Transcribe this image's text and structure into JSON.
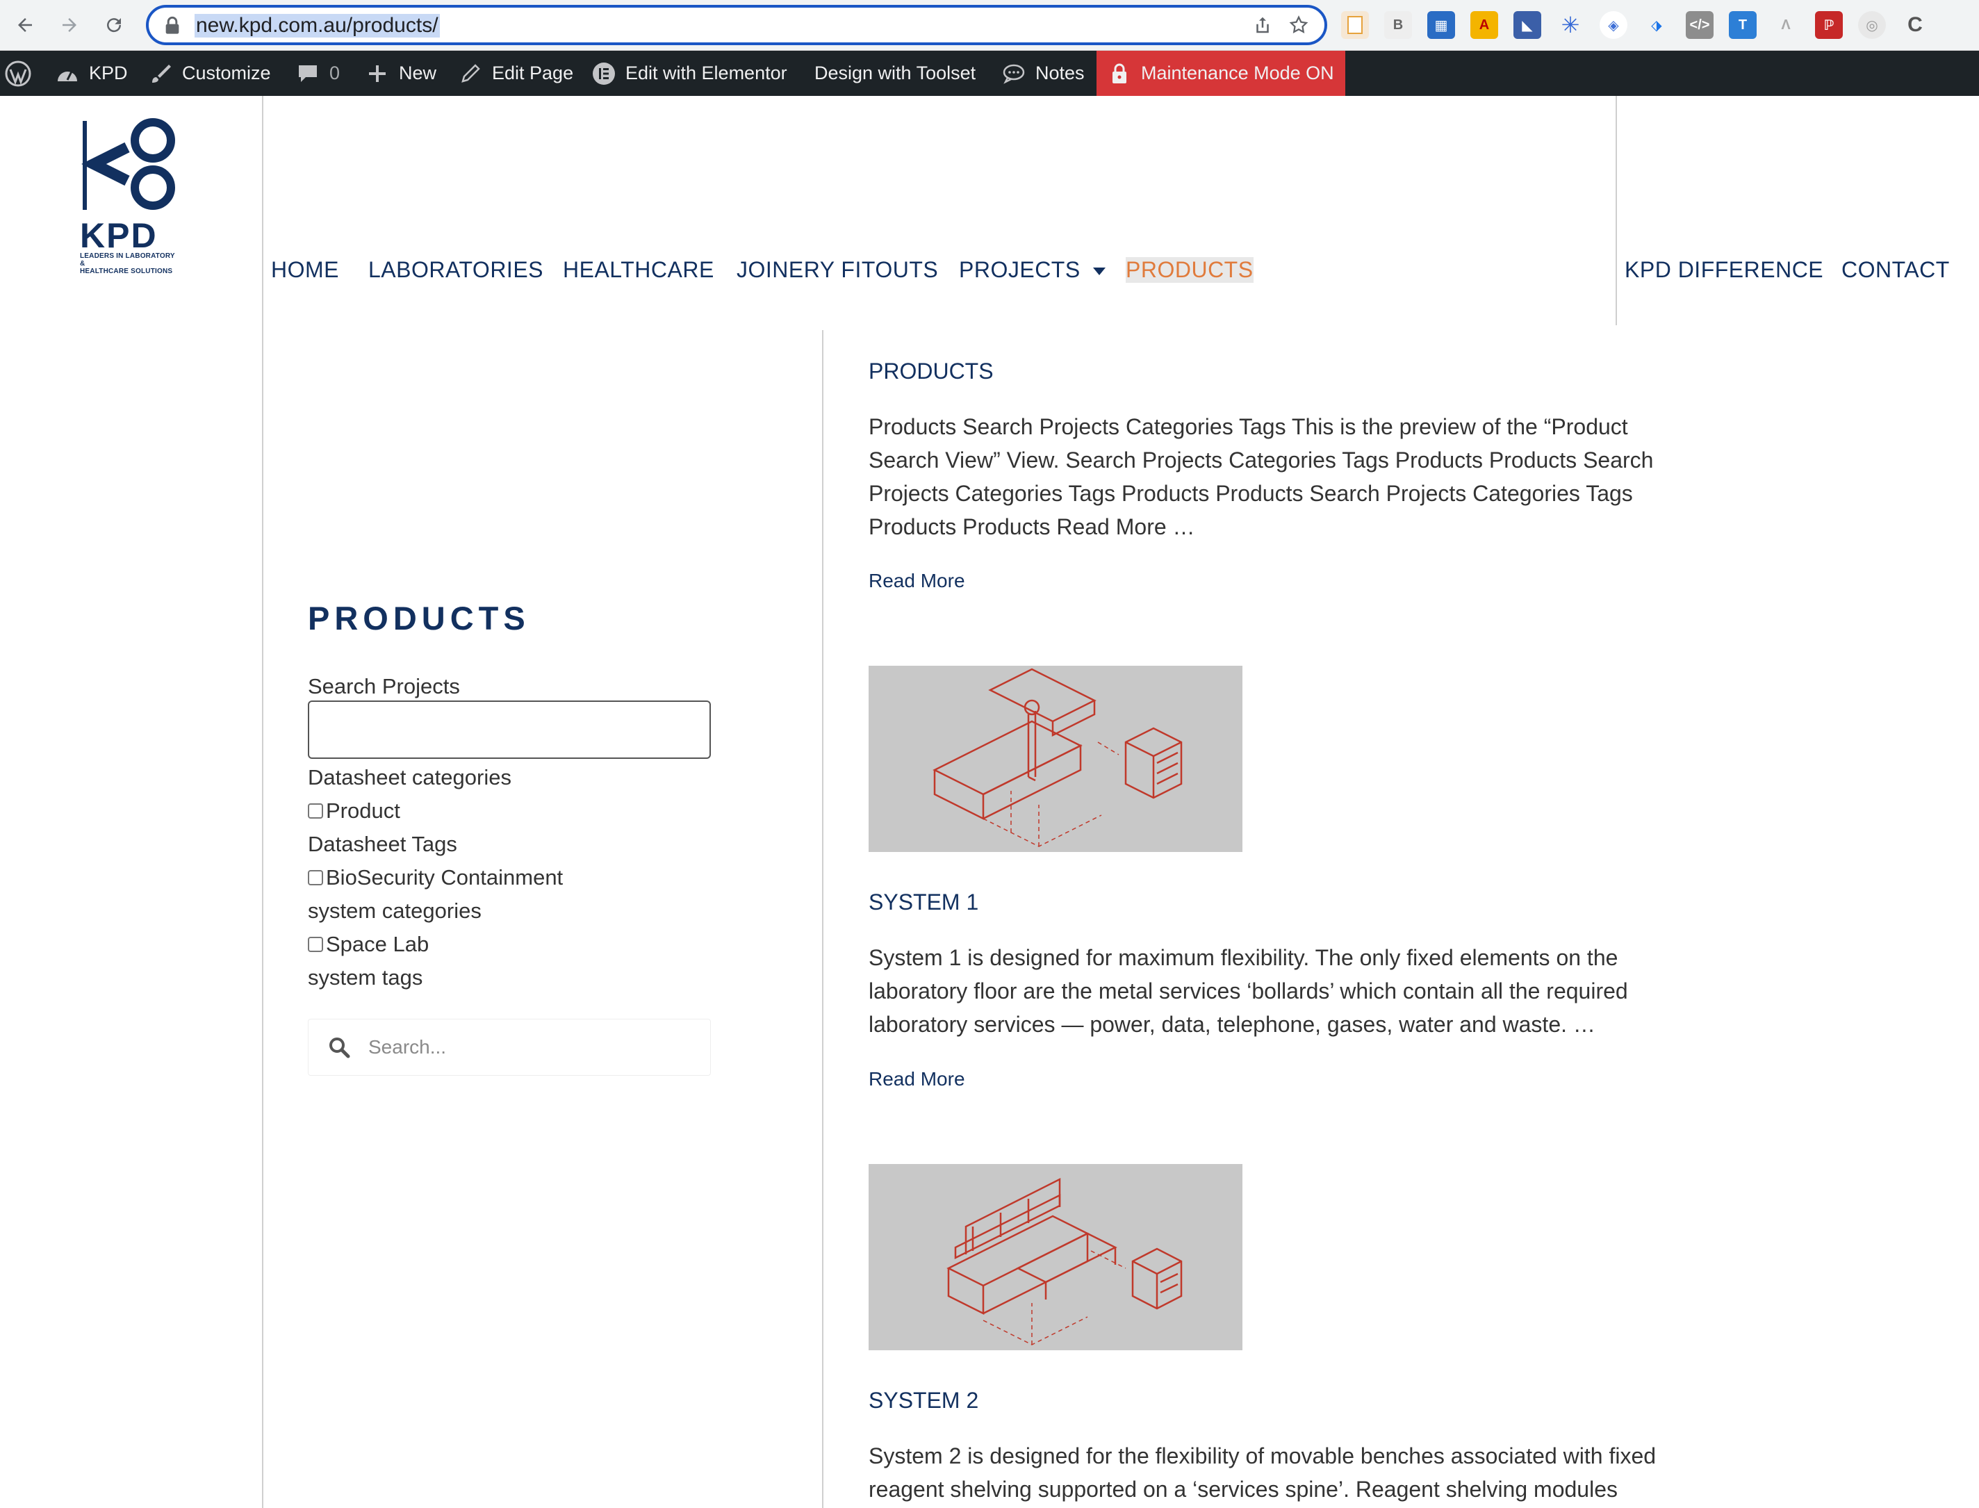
{
  "browser": {
    "url": "new.kpd.com.au/products/"
  },
  "adminbar": {
    "site": "KPD",
    "customize": "Customize",
    "comments_count": "0",
    "new": "New",
    "edit_page": "Edit Page",
    "edit_elementor": "Edit with Elementor",
    "design_toolset": "Design with Toolset",
    "notes": "Notes",
    "maintenance": "Maintenance Mode ON"
  },
  "logo": {
    "word": "KPD",
    "tag_line1": "LEADERS IN LABORATORY &",
    "tag_line2": "HEALTHCARE SOLUTIONS"
  },
  "menu": {
    "home": "HOME",
    "laboratories": "LABORATORIES",
    "healthcare": "HEALTHCARE",
    "joinery": "JOINERY FITOUTS",
    "projects": "PROJECTS",
    "products": "PRODUCTS",
    "difference": "KPD DIFFERENCE",
    "contact": "CONTACT"
  },
  "sidebar": {
    "title": "PRODUCTS",
    "search_label": "Search Projects",
    "datasheet_categories": "Datasheet categories",
    "product": "Product",
    "datasheet_tags": "Datasheet Tags",
    "biosecurity": "BioSecurity Containment",
    "system_categories": "system categories",
    "space_lab": "Space Lab",
    "system_tags": "system tags",
    "search_placeholder": "Search..."
  },
  "posts": [
    {
      "title": "PRODUCTS",
      "excerpt": "Products Search Projects Categories Tags This is the preview of the “Product Search View” View. Search Projects Categories Tags Products Products Search Projects Categories Tags Products Products Search Projects Categories Tags Products Products Read More …",
      "read_more": "Read More"
    },
    {
      "title": "SYSTEM 1",
      "excerpt": "System 1 is designed for maximum flexibility. The only fixed elements on the laboratory floor are the metal services ‘bollards’ which contain all the required laboratory services — power, data, telephone, gases, water and waste. …",
      "read_more": "Read More"
    },
    {
      "title": "SYSTEM 2",
      "excerpt": "System 2 is designed for the flexibility of movable benches associated with fixed reagent shelving supported on a ‘services spine’. Reagent shelving modules"
    }
  ],
  "colors": {
    "brand_navy": "#12305f",
    "active_orange": "#e07b3c",
    "adminbar_bg": "#1d2327",
    "maintenance_red": "#d63638",
    "sketch_red": "#c0392b"
  }
}
